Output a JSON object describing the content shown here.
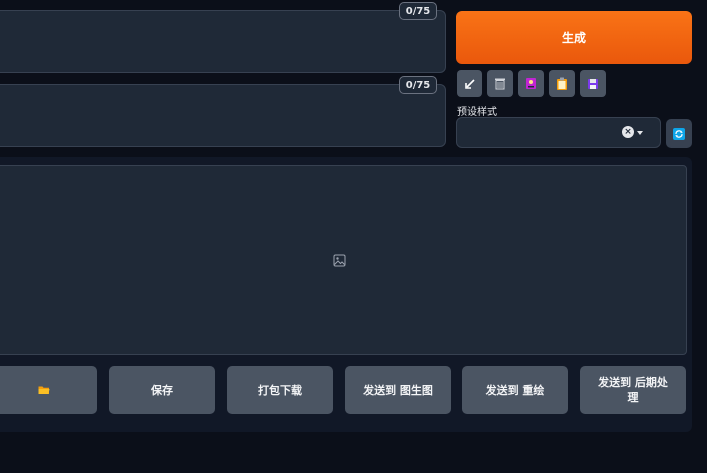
{
  "prompt": {
    "token_counter": "0/75",
    "value": ""
  },
  "negative_prompt": {
    "token_counter": "0/75",
    "value": ""
  },
  "generate": {
    "label": "生成"
  },
  "tools": {
    "icons": [
      "arrow-icon",
      "trash-icon",
      "image-icon",
      "clipboard-icon",
      "floppy-disk-icon"
    ]
  },
  "styles": {
    "label": "预设样式",
    "selected_value": ""
  },
  "gallery": {
    "placeholder_icon": "image-placeholder-icon"
  },
  "actions": {
    "folder_icon": "folder-icon",
    "save_label": "保存",
    "zip_label": "打包下载",
    "send_img2img_label": "发送到 图生图",
    "send_inpaint_label": "发送到 重绘",
    "send_extras_label": "发送到 后期处理"
  },
  "colors": {
    "background": "#0b0f19",
    "panel": "#1f2937",
    "accent_orange": "#f97316",
    "button_gray": "#4b5563",
    "refresh_blue": "#0ea5e9"
  }
}
